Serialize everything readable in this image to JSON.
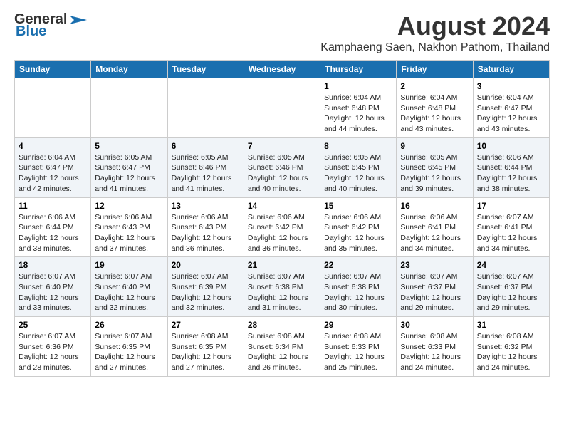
{
  "logo": {
    "general": "General",
    "blue": "Blue"
  },
  "title": "August 2024",
  "subtitle": "Kamphaeng Saen, Nakhon Pathom, Thailand",
  "headers": [
    "Sunday",
    "Monday",
    "Tuesday",
    "Wednesday",
    "Thursday",
    "Friday",
    "Saturday"
  ],
  "weeks": [
    [
      {
        "day": "",
        "info": ""
      },
      {
        "day": "",
        "info": ""
      },
      {
        "day": "",
        "info": ""
      },
      {
        "day": "",
        "info": ""
      },
      {
        "day": "1",
        "info": "Sunrise: 6:04 AM\nSunset: 6:48 PM\nDaylight: 12 hours\nand 44 minutes."
      },
      {
        "day": "2",
        "info": "Sunrise: 6:04 AM\nSunset: 6:48 PM\nDaylight: 12 hours\nand 43 minutes."
      },
      {
        "day": "3",
        "info": "Sunrise: 6:04 AM\nSunset: 6:47 PM\nDaylight: 12 hours\nand 43 minutes."
      }
    ],
    [
      {
        "day": "4",
        "info": "Sunrise: 6:04 AM\nSunset: 6:47 PM\nDaylight: 12 hours\nand 42 minutes."
      },
      {
        "day": "5",
        "info": "Sunrise: 6:05 AM\nSunset: 6:47 PM\nDaylight: 12 hours\nand 41 minutes."
      },
      {
        "day": "6",
        "info": "Sunrise: 6:05 AM\nSunset: 6:46 PM\nDaylight: 12 hours\nand 41 minutes."
      },
      {
        "day": "7",
        "info": "Sunrise: 6:05 AM\nSunset: 6:46 PM\nDaylight: 12 hours\nand 40 minutes."
      },
      {
        "day": "8",
        "info": "Sunrise: 6:05 AM\nSunset: 6:45 PM\nDaylight: 12 hours\nand 40 minutes."
      },
      {
        "day": "9",
        "info": "Sunrise: 6:05 AM\nSunset: 6:45 PM\nDaylight: 12 hours\nand 39 minutes."
      },
      {
        "day": "10",
        "info": "Sunrise: 6:06 AM\nSunset: 6:44 PM\nDaylight: 12 hours\nand 38 minutes."
      }
    ],
    [
      {
        "day": "11",
        "info": "Sunrise: 6:06 AM\nSunset: 6:44 PM\nDaylight: 12 hours\nand 38 minutes."
      },
      {
        "day": "12",
        "info": "Sunrise: 6:06 AM\nSunset: 6:43 PM\nDaylight: 12 hours\nand 37 minutes."
      },
      {
        "day": "13",
        "info": "Sunrise: 6:06 AM\nSunset: 6:43 PM\nDaylight: 12 hours\nand 36 minutes."
      },
      {
        "day": "14",
        "info": "Sunrise: 6:06 AM\nSunset: 6:42 PM\nDaylight: 12 hours\nand 36 minutes."
      },
      {
        "day": "15",
        "info": "Sunrise: 6:06 AM\nSunset: 6:42 PM\nDaylight: 12 hours\nand 35 minutes."
      },
      {
        "day": "16",
        "info": "Sunrise: 6:06 AM\nSunset: 6:41 PM\nDaylight: 12 hours\nand 34 minutes."
      },
      {
        "day": "17",
        "info": "Sunrise: 6:07 AM\nSunset: 6:41 PM\nDaylight: 12 hours\nand 34 minutes."
      }
    ],
    [
      {
        "day": "18",
        "info": "Sunrise: 6:07 AM\nSunset: 6:40 PM\nDaylight: 12 hours\nand 33 minutes."
      },
      {
        "day": "19",
        "info": "Sunrise: 6:07 AM\nSunset: 6:40 PM\nDaylight: 12 hours\nand 32 minutes."
      },
      {
        "day": "20",
        "info": "Sunrise: 6:07 AM\nSunset: 6:39 PM\nDaylight: 12 hours\nand 32 minutes."
      },
      {
        "day": "21",
        "info": "Sunrise: 6:07 AM\nSunset: 6:38 PM\nDaylight: 12 hours\nand 31 minutes."
      },
      {
        "day": "22",
        "info": "Sunrise: 6:07 AM\nSunset: 6:38 PM\nDaylight: 12 hours\nand 30 minutes."
      },
      {
        "day": "23",
        "info": "Sunrise: 6:07 AM\nSunset: 6:37 PM\nDaylight: 12 hours\nand 29 minutes."
      },
      {
        "day": "24",
        "info": "Sunrise: 6:07 AM\nSunset: 6:37 PM\nDaylight: 12 hours\nand 29 minutes."
      }
    ],
    [
      {
        "day": "25",
        "info": "Sunrise: 6:07 AM\nSunset: 6:36 PM\nDaylight: 12 hours\nand 28 minutes."
      },
      {
        "day": "26",
        "info": "Sunrise: 6:07 AM\nSunset: 6:35 PM\nDaylight: 12 hours\nand 27 minutes."
      },
      {
        "day": "27",
        "info": "Sunrise: 6:08 AM\nSunset: 6:35 PM\nDaylight: 12 hours\nand 27 minutes."
      },
      {
        "day": "28",
        "info": "Sunrise: 6:08 AM\nSunset: 6:34 PM\nDaylight: 12 hours\nand 26 minutes."
      },
      {
        "day": "29",
        "info": "Sunrise: 6:08 AM\nSunset: 6:33 PM\nDaylight: 12 hours\nand 25 minutes."
      },
      {
        "day": "30",
        "info": "Sunrise: 6:08 AM\nSunset: 6:33 PM\nDaylight: 12 hours\nand 24 minutes."
      },
      {
        "day": "31",
        "info": "Sunrise: 6:08 AM\nSunset: 6:32 PM\nDaylight: 12 hours\nand 24 minutes."
      }
    ]
  ]
}
